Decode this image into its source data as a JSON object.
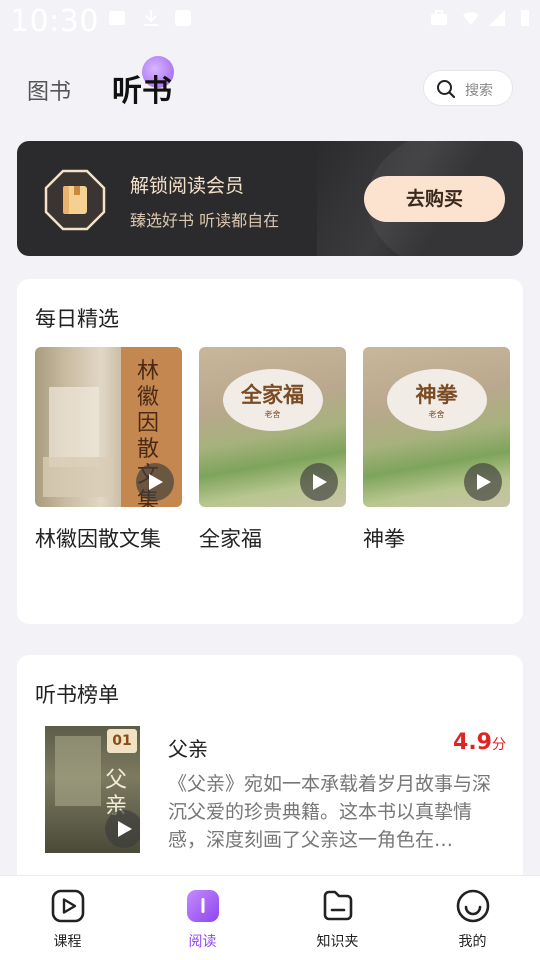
{
  "status_bar": {
    "time": "10:30"
  },
  "header": {
    "tabs": [
      {
        "label": "图书",
        "active": false
      },
      {
        "label": "听书",
        "active": true
      }
    ],
    "search_placeholder": "搜索"
  },
  "vip_banner": {
    "title": "解锁阅读会员",
    "subtitle": "臻选好书 听读都自在",
    "button_label": "去购买"
  },
  "daily_picks": {
    "title": "每日精选",
    "books": [
      {
        "title": "林徽因散文集",
        "cover_text": "林徽因散文集"
      },
      {
        "title": "全家福",
        "cover_text": "全家福",
        "cover_author": "老舍"
      },
      {
        "title": "神拳",
        "cover_text": "神拳",
        "cover_author": "老舍"
      }
    ]
  },
  "ranking": {
    "title": "听书榜单",
    "items": [
      {
        "rank": "01",
        "title": "父亲",
        "cover_text": "父亲",
        "score": "4.9",
        "score_unit": "分",
        "description": "《父亲》宛如一本承载着岁月故事与深沉父爱的珍贵典籍。这本书以真挚情感，深度刻画了父亲这一角色在…"
      }
    ]
  },
  "bottom_nav": {
    "items": [
      {
        "label": "课程",
        "icon": "play-square-icon",
        "active": false
      },
      {
        "label": "阅读",
        "icon": "book-icon",
        "active": true
      },
      {
        "label": "知识夹",
        "icon": "folder-icon",
        "active": false
      },
      {
        "label": "我的",
        "icon": "smile-face-icon",
        "active": false
      }
    ]
  },
  "colors": {
    "accent": "#8e44f0",
    "score": "#e02424",
    "banner_bg": "#2b2a2d",
    "banner_button": "#fbe3cf"
  }
}
